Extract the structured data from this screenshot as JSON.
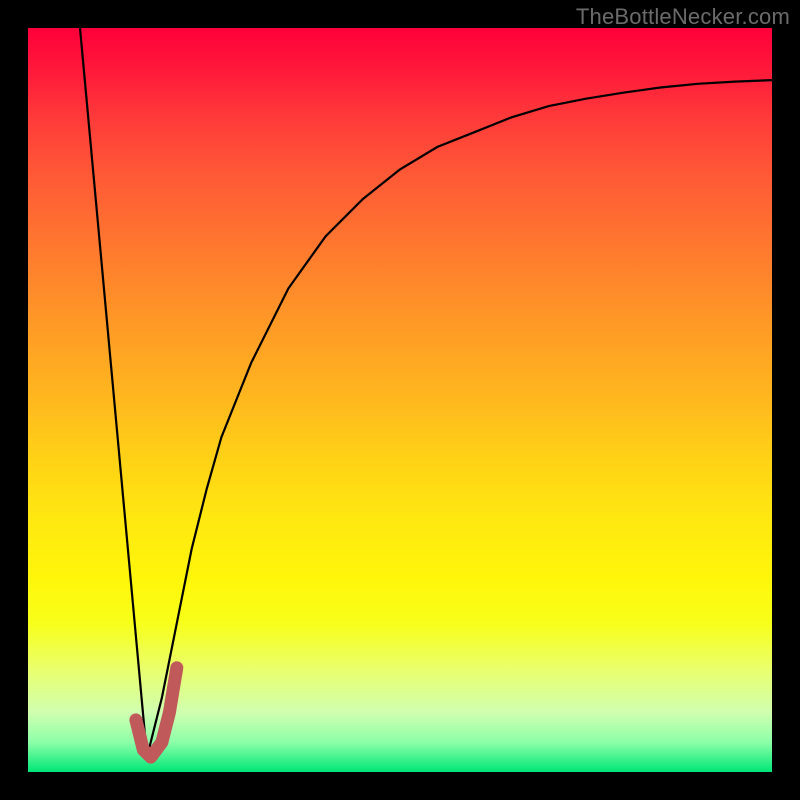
{
  "watermark": {
    "text": "TheBottleNecker.com"
  },
  "chart_data": {
    "type": "line",
    "title": "",
    "xlabel": "",
    "ylabel": "",
    "xlim": [
      0,
      100
    ],
    "ylim": [
      0,
      100
    ],
    "grid": false,
    "legend": false,
    "series": [
      {
        "name": "left-descending-line",
        "color": "#000000",
        "x": [
          7,
          16
        ],
        "values": [
          100,
          2
        ]
      },
      {
        "name": "right-rising-curve",
        "color": "#000000",
        "x": [
          16,
          18,
          20,
          22,
          24,
          26,
          30,
          35,
          40,
          45,
          50,
          55,
          60,
          65,
          70,
          75,
          80,
          85,
          90,
          95,
          100
        ],
        "values": [
          2,
          10,
          20,
          30,
          38,
          45,
          55,
          65,
          72,
          77,
          81,
          84,
          86,
          88,
          89.5,
          90.5,
          91.3,
          92,
          92.5,
          92.8,
          93
        ]
      },
      {
        "name": "red-hook-segment",
        "color": "#c05a5a",
        "x": [
          14.5,
          15.5,
          16.5,
          18,
          19,
          20
        ],
        "values": [
          7,
          3,
          2,
          4,
          8,
          14
        ]
      }
    ],
    "background_gradient": {
      "top": "#ff003a",
      "bottom": "#00e676"
    }
  }
}
